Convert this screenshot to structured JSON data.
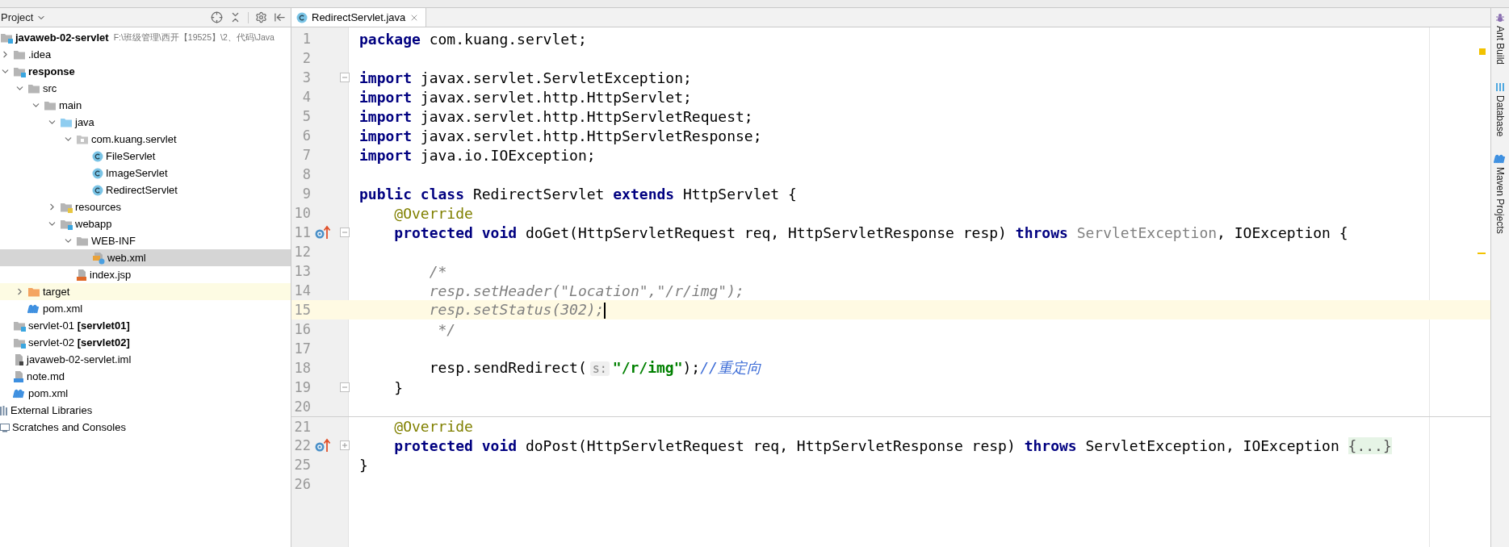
{
  "project_panel": {
    "title": "Project",
    "tree": [
      {
        "label": "javaweb-02-servlet",
        "path": "F:\\班级管理\\西开【19525】\\2、代码\\Java",
        "kind": "module",
        "bold": true,
        "expanded": true,
        "selected": false,
        "hovered": false,
        "children": [
          {
            "label": ".idea",
            "kind": "folder",
            "bold": false,
            "expanded": false,
            "selected": false,
            "hovered": false
          },
          {
            "label": "response",
            "kind": "module",
            "bold": true,
            "expanded": true,
            "selected": false,
            "hovered": false,
            "children": [
              {
                "label": "src",
                "kind": "folder",
                "bold": false,
                "expanded": true,
                "selected": false,
                "hovered": false,
                "children": [
                  {
                    "label": "main",
                    "kind": "folder",
                    "bold": false,
                    "expanded": true,
                    "selected": false,
                    "hovered": false,
                    "children": [
                      {
                        "label": "java",
                        "kind": "source-folder",
                        "bold": false,
                        "expanded": true,
                        "selected": false,
                        "hovered": false,
                        "children": [
                          {
                            "label": "com.kuang.servlet",
                            "kind": "package",
                            "bold": false,
                            "expanded": true,
                            "selected": false,
                            "hovered": false,
                            "children": [
                              {
                                "label": "FileServlet",
                                "kind": "class",
                                "bold": false,
                                "selected": false,
                                "hovered": false
                              },
                              {
                                "label": "ImageServlet",
                                "kind": "class",
                                "bold": false,
                                "selected": false,
                                "hovered": false
                              },
                              {
                                "label": "RedirectServlet",
                                "kind": "class",
                                "bold": false,
                                "selected": false,
                                "hovered": false
                              }
                            ]
                          }
                        ]
                      },
                      {
                        "label": "resources",
                        "kind": "resources-folder",
                        "bold": false,
                        "expanded": false,
                        "selected": false,
                        "hovered": false
                      },
                      {
                        "label": "webapp",
                        "kind": "web-folder",
                        "bold": false,
                        "expanded": true,
                        "selected": false,
                        "hovered": false,
                        "children": [
                          {
                            "label": "WEB-INF",
                            "kind": "folder",
                            "bold": false,
                            "expanded": true,
                            "selected": false,
                            "hovered": false,
                            "children": [
                              {
                                "label": "web.xml",
                                "kind": "xml",
                                "bold": false,
                                "selected": true,
                                "hovered": false
                              }
                            ]
                          },
                          {
                            "label": "index.jsp",
                            "kind": "jsp",
                            "bold": false,
                            "selected": false,
                            "hovered": false
                          }
                        ]
                      }
                    ]
                  }
                ]
              },
              {
                "label": "target",
                "kind": "excluded-folder",
                "bold": false,
                "expanded": false,
                "selected": false,
                "hovered": true
              },
              {
                "label": "pom.xml",
                "kind": "maven",
                "bold": false,
                "selected": false,
                "hovered": false
              }
            ]
          },
          {
            "label": "servlet-01 **[servlet01]**",
            "kind": "module",
            "bold": false,
            "selected": false,
            "hovered": false
          },
          {
            "label": "servlet-02 **[servlet02]**",
            "kind": "module",
            "bold": false,
            "selected": false,
            "hovered": false
          },
          {
            "label": "javaweb-02-servlet.iml",
            "kind": "iml",
            "bold": false,
            "selected": false,
            "hovered": false
          },
          {
            "label": "note.md",
            "kind": "md",
            "bold": false,
            "selected": false,
            "hovered": false
          },
          {
            "label": "pom.xml",
            "kind": "maven",
            "bold": false,
            "selected": false,
            "hovered": false
          }
        ]
      },
      {
        "label": "External Libraries",
        "kind": "libraries",
        "bold": false,
        "selected": false,
        "hovered": false
      },
      {
        "label": "Scratches and Consoles",
        "kind": "scratches",
        "bold": false,
        "selected": false,
        "hovered": false
      }
    ]
  },
  "editor": {
    "tabs": [
      {
        "label": "RedirectServlet.java",
        "selected": true
      }
    ],
    "lines": [
      {
        "number": "1",
        "current": false,
        "tokens": [
          {
            "kind": "kw",
            "text": "package"
          },
          {
            "kind": "plain",
            "text": " com.kuang.servlet;"
          }
        ]
      },
      {
        "number": "2",
        "current": false
      },
      {
        "number": "3",
        "current": false,
        "fold_expanded": true,
        "tokens": [
          {
            "kind": "kw",
            "text": "import"
          },
          {
            "kind": "plain",
            "text": " javax.servlet.ServletException;"
          }
        ]
      },
      {
        "number": "4",
        "current": false,
        "tokens": [
          {
            "kind": "kw",
            "text": "import"
          },
          {
            "kind": "plain",
            "text": " javax.servlet.http.HttpServlet;"
          }
        ]
      },
      {
        "number": "5",
        "current": false,
        "tokens": [
          {
            "kind": "kw",
            "text": "import"
          },
          {
            "kind": "plain",
            "text": " javax.servlet.http.HttpServletRequest;"
          }
        ]
      },
      {
        "number": "6",
        "current": false,
        "tokens": [
          {
            "kind": "kw",
            "text": "import"
          },
          {
            "kind": "plain",
            "text": " javax.servlet.http.HttpServletResponse;"
          }
        ]
      },
      {
        "number": "7",
        "current": false,
        "tokens": [
          {
            "kind": "kw",
            "text": "import"
          },
          {
            "kind": "plain",
            "text": " java.io.IOException;"
          }
        ]
      },
      {
        "number": "8",
        "current": false
      },
      {
        "number": "9",
        "current": false,
        "tokens": [
          {
            "kind": "kw",
            "text": "public class"
          },
          {
            "kind": "plain",
            "text": " RedirectServlet "
          },
          {
            "kind": "kw",
            "text": "extends"
          },
          {
            "kind": "plain",
            "text": " HttpServlet {"
          }
        ]
      },
      {
        "number": "10",
        "current": false,
        "tokens": [
          {
            "kind": "ann",
            "text": "    @Override"
          }
        ]
      },
      {
        "number": "11",
        "current": false,
        "override_marker": true,
        "fold_expanded": true,
        "tokens": [
          {
            "kind": "kw",
            "text": "    protected void"
          },
          {
            "kind": "plain",
            "text": " doGet(HttpServletRequest req, HttpServletResponse resp) "
          },
          {
            "kind": "kw",
            "text": "throws"
          },
          {
            "kind": "unused",
            "text": " ServletException"
          },
          {
            "kind": "plain",
            "text": ", IOException {"
          }
        ]
      },
      {
        "number": "12",
        "current": false
      },
      {
        "number": "13",
        "current": false,
        "tokens": [
          {
            "kind": "comment",
            "text": "        /*"
          }
        ]
      },
      {
        "number": "14",
        "current": false,
        "tokens": [
          {
            "kind": "comment",
            "text": "        resp.setHeader(\"Location\",\"/r/img\");"
          }
        ]
      },
      {
        "number": "15",
        "current": true,
        "tokens": [
          {
            "kind": "comment",
            "text": "        resp.setStatus(302);"
          }
        ]
      },
      {
        "number": "16",
        "current": false,
        "tokens": [
          {
            "kind": "comment",
            "text": "         */"
          }
        ]
      },
      {
        "number": "17",
        "current": false
      },
      {
        "number": "18",
        "current": false,
        "tokens": [
          {
            "kind": "plain",
            "text": "        resp.sendRedirect("
          },
          {
            "kind": "hint",
            "text": "s:"
          },
          {
            "kind": "str",
            "text": "\"/r/img\""
          },
          {
            "kind": "plain",
            "text": ");"
          },
          {
            "kind": "doc",
            "text": "//重定向"
          }
        ]
      },
      {
        "number": "19",
        "current": false,
        "fold_expanded": true,
        "tokens": [
          {
            "kind": "plain",
            "text": "    }"
          }
        ]
      },
      {
        "number": "20",
        "current": false
      },
      {
        "number": "21",
        "current": false,
        "separator": true,
        "tokens": [
          {
            "kind": "ann",
            "text": "    @Override"
          }
        ]
      },
      {
        "number": "22",
        "current": false,
        "override_marker": true,
        "fold_expanded": false,
        "tokens": [
          {
            "kind": "kw",
            "text": "    protected void"
          },
          {
            "kind": "plain",
            "text": " doPost(HttpServletRequest req, HttpServletResponse resp) "
          },
          {
            "kind": "kw",
            "text": "throws"
          },
          {
            "kind": "plain",
            "text": " ServletException, IOException "
          },
          {
            "kind": "fold",
            "text": "{...}"
          }
        ]
      },
      {
        "number": "25",
        "current": false,
        "tokens": [
          {
            "kind": "plain",
            "text": "}"
          }
        ]
      },
      {
        "number": "26",
        "current": false
      }
    ]
  },
  "tool_windows": [
    {
      "label": "Ant Build",
      "kind": "ant"
    },
    {
      "label": "Database",
      "kind": "database"
    },
    {
      "label": "Maven Projects",
      "kind": "maven"
    }
  ]
}
